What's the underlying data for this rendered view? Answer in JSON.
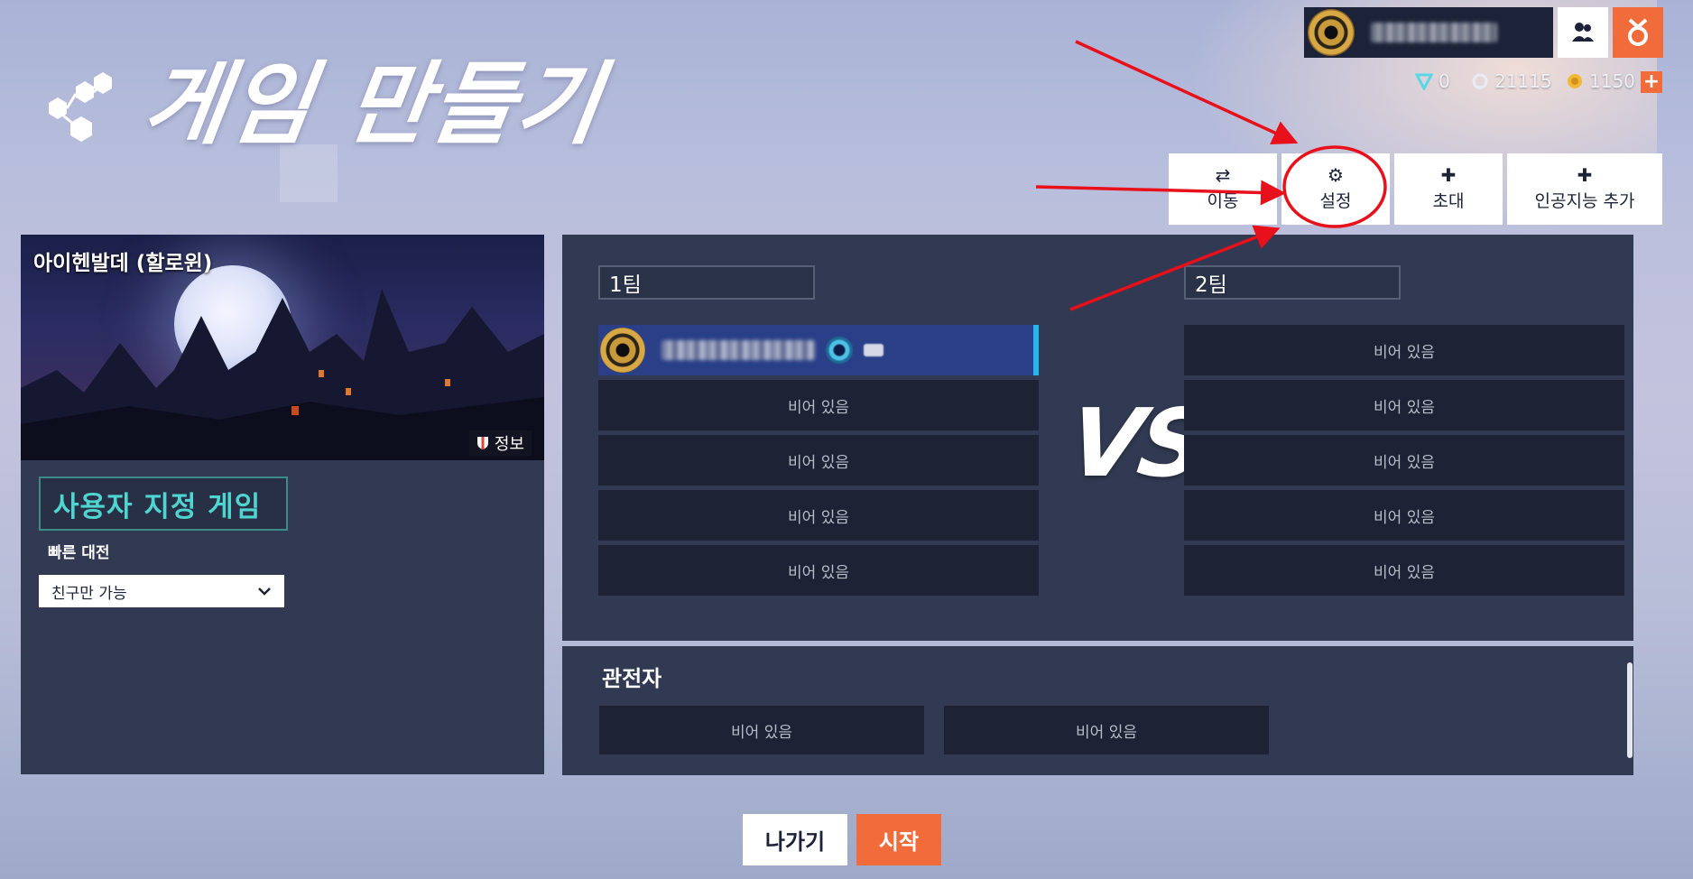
{
  "page": {
    "title": "게임 만들기",
    "logo_icon": "hexagon-network-icon"
  },
  "header": {
    "player_name": "",
    "currencies": [
      {
        "icon": "legacy-credit-icon",
        "color": "#5ad7e6",
        "value": "0"
      },
      {
        "icon": "credit-icon",
        "color": "#e8ecf7",
        "value": "21115"
      },
      {
        "icon": "coin-icon",
        "color": "#f2b733",
        "value": "1150"
      }
    ],
    "plus_label": "+",
    "social_icon": "friends-icon",
    "medal_icon": "medal-icon"
  },
  "actions": [
    {
      "label": "이동",
      "icon": "move-icon"
    },
    {
      "label": "설정",
      "icon": "gear-icon"
    },
    {
      "label": "초대",
      "icon": "invite-icon"
    },
    {
      "label": "인공지능 추가",
      "icon": "add-ai-icon"
    }
  ],
  "map": {
    "name": "아이헨발데 (할로윈)",
    "info_label": "정보"
  },
  "mode": {
    "name": "사용자 지정 게임",
    "subtitle": "빠른 대전",
    "privacy_selected": "친구만 가능"
  },
  "teams": {
    "team1": {
      "name": "1팀",
      "slots": [
        "비어 있음",
        "비어 있음",
        "비어 있음",
        "비어 있음"
      ]
    },
    "team2": {
      "name": "2팀",
      "slots": [
        "비어 있음",
        "비어 있음",
        "비어 있음",
        "비어 있음",
        "비어 있음"
      ]
    },
    "vs_label": "VS"
  },
  "spectators": {
    "title": "관전자",
    "slots": [
      "비어 있음",
      "비어 있음"
    ]
  },
  "footer": {
    "leave_label": "나가기",
    "start_label": "시작"
  },
  "colors": {
    "accent": "#f26b3a",
    "panel": "#313a52",
    "slot": "#1d2234",
    "player_slot": "#2a3f88",
    "mode_text": "#4fd4cf",
    "annotation": "#e8101a"
  }
}
